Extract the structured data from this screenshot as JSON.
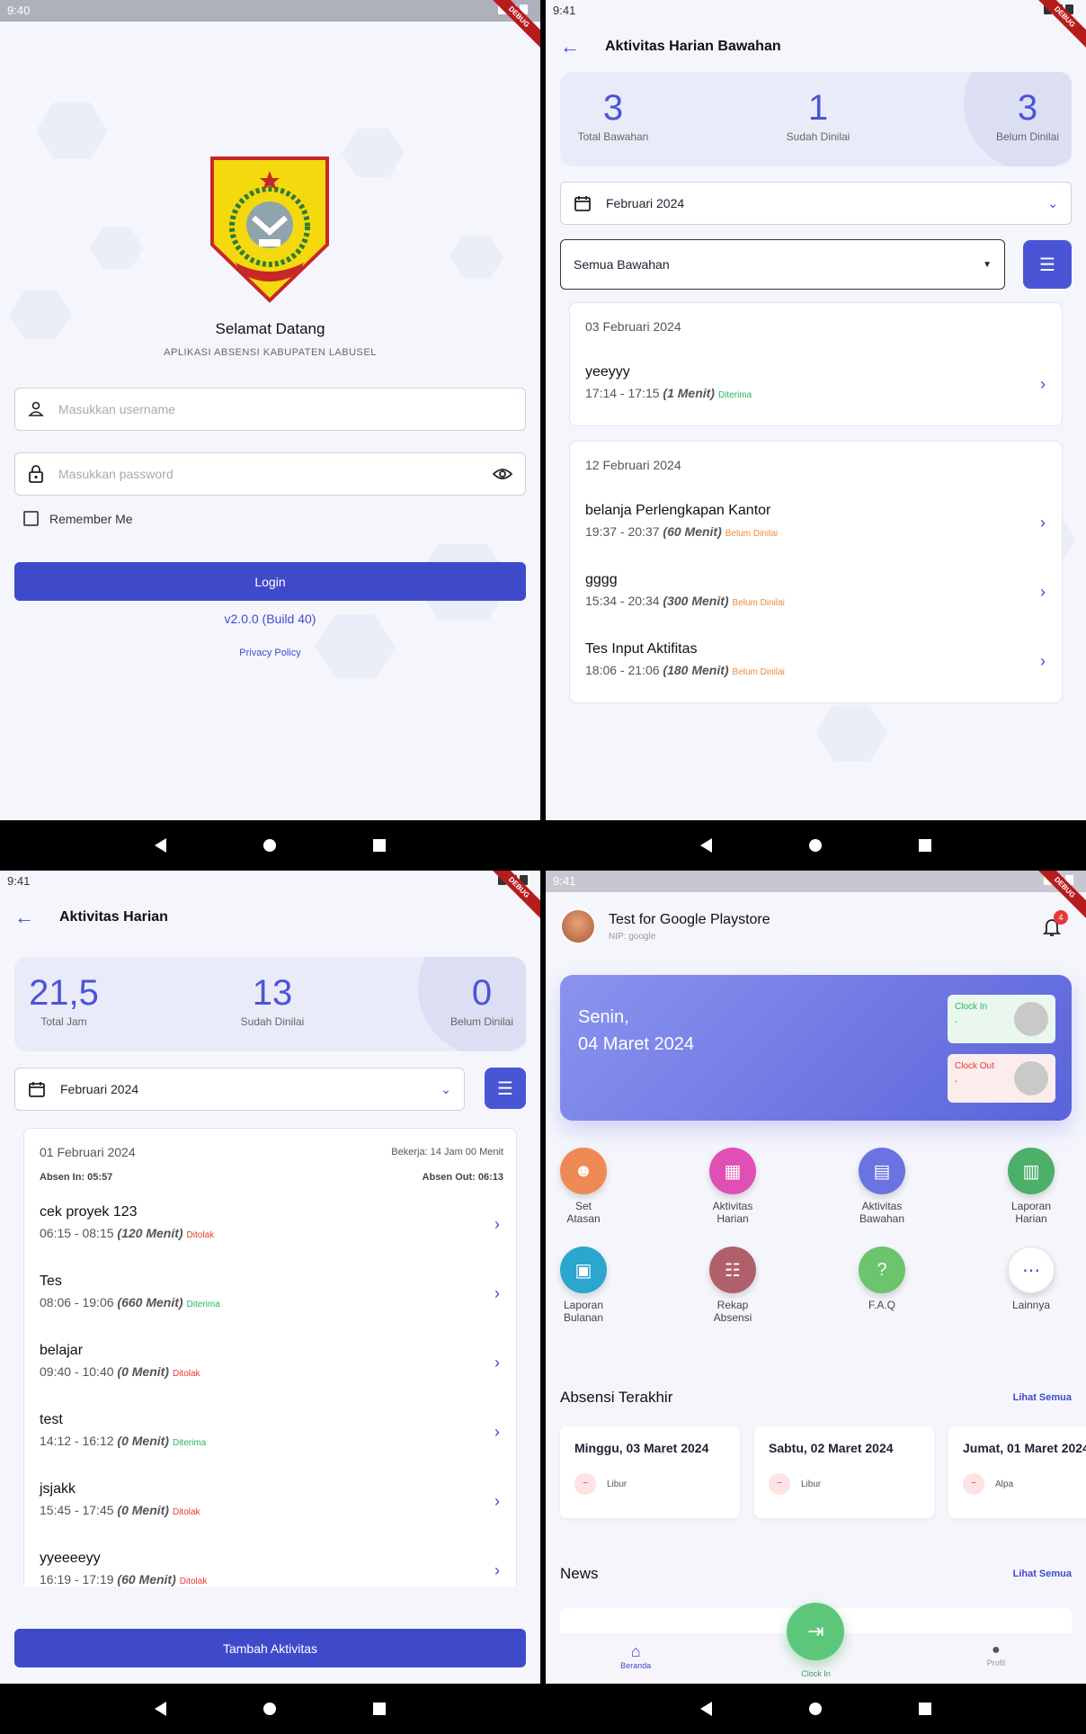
{
  "q1": {
    "time": "9:40",
    "debug": "DEBUG",
    "welcome": "Selamat Datang",
    "subtitle": "APLIKASI ABSENSI KABUPATEN LABUSEL",
    "username_placeholder": "Masukkan username",
    "password_placeholder": "Masukkan password",
    "remember": "Remember Me",
    "login": "Login",
    "version": "v2.0.0 (Build 40)",
    "privacy": "Privacy Policy"
  },
  "q2": {
    "time": "9:41",
    "title": "Aktivitas Harian Bawahan",
    "stats": [
      {
        "num": "3",
        "label": "Total Bawahan"
      },
      {
        "num": "1",
        "label": "Sudah Dinilai"
      },
      {
        "num": "3",
        "label": "Belum Dinilai"
      }
    ],
    "month": "Februari 2024",
    "filter": "Semua Bawahan",
    "groups": [
      {
        "date": "03 Februari 2024",
        "items": [
          {
            "name": "yeeyyy",
            "time": "17:14 - 17:15",
            "dur": "(1 Menit)",
            "status": "Diterima"
          }
        ]
      },
      {
        "date": "12 Februari 2024",
        "items": [
          {
            "name": "belanja Perlengkapan Kantor",
            "time": "19:37 - 20:37",
            "dur": "(60 Menit)",
            "status": "Belum Dinilai"
          },
          {
            "name": "gggg",
            "time": "15:34 - 20:34",
            "dur": "(300 Menit)",
            "status": "Belum Dinilai"
          },
          {
            "name": "Tes Input Aktifitas",
            "time": "18:06 - 21:06",
            "dur": "(180 Menit)",
            "status": "Belum Dinilai"
          }
        ]
      }
    ]
  },
  "q3": {
    "time": "9:41",
    "title": "Aktivitas Harian",
    "stats": [
      {
        "num": "21,5",
        "label": "Total Jam"
      },
      {
        "num": "13",
        "label": "Sudah Dinilai"
      },
      {
        "num": "0",
        "label": "Belum Dinilai"
      }
    ],
    "month": "Februari 2024",
    "card_date": "01 Februari 2024",
    "bekerja": "Bekerja: 14 Jam 00 Menit",
    "absen_in": "Absen In: 05:57",
    "absen_out": "Absen Out: 06:13",
    "items": [
      {
        "name": "cek proyek 123",
        "time": "06:15 - 08:15",
        "dur": "(120 Menit)",
        "status": "Ditolak"
      },
      {
        "name": "Tes",
        "time": "08:06 - 19:06",
        "dur": "(660 Menit)",
        "status": "Diterima"
      },
      {
        "name": "belajar",
        "time": "09:40 - 10:40",
        "dur": "(0 Menit)",
        "status": "Ditolak"
      },
      {
        "name": "test",
        "time": "14:12 - 16:12",
        "dur": "(0 Menit)",
        "status": "Diterima"
      },
      {
        "name": "jsjakk",
        "time": "15:45 - 17:45",
        "dur": "(0 Menit)",
        "status": "Ditolak"
      },
      {
        "name": "yyeeeeyy",
        "time": "16:19 - 17:19",
        "dur": "(60 Menit)",
        "status": "Ditolak"
      }
    ],
    "add_button": "Tambah Aktivitas"
  },
  "q4": {
    "time": "9:41",
    "user": "Test for Google Playstore",
    "nip": "NIP: google",
    "notif_count": "4",
    "day": "Senin,",
    "date": "04 Maret 2024",
    "clock_in_label": "Clock In",
    "clock_in_value": "-",
    "clock_out_label": "Clock Out",
    "clock_out_value": "-",
    "menu": [
      {
        "label": "Set\nAtasan",
        "color": "#ef8a55",
        "icon": "people-icon"
      },
      {
        "label": "Aktivitas\nHarian",
        "color": "#e04fb3",
        "icon": "calendar-icon"
      },
      {
        "label": "Aktivitas\nBawahan",
        "color": "#6a73e0",
        "icon": "clipboard-icon"
      },
      {
        "label": "Laporan\nHarian",
        "color": "#4caf6a",
        "icon": "document-icon"
      },
      {
        "label": "Laporan\nBulanan",
        "color": "#2aa6cf",
        "icon": "report-icon"
      },
      {
        "label": "Rekap\nAbsensi",
        "color": "#b0606a",
        "icon": "checklist-icon"
      },
      {
        "label": "F.A.Q",
        "color": "#6cc46c",
        "icon": "help-icon"
      },
      {
        "label": "Lainnya",
        "color": "#ffffff",
        "icon": "more-icon"
      }
    ],
    "absensi_title": "Absensi Terakhir",
    "lihat_semua": "Lihat Semua",
    "absensi": [
      {
        "date": "Minggu, 03 Maret 2024",
        "status": "Libur"
      },
      {
        "date": "Sabtu, 02 Maret 2024",
        "status": "Libur"
      },
      {
        "date": "Jumat, 01 Maret 2024",
        "status": "Alpa"
      }
    ],
    "news_title": "News",
    "news_link": "Lihat Semua",
    "nav": {
      "home": "Beranda",
      "clock": "Clock In",
      "profile": "Profil"
    }
  },
  "colors": {
    "primary": "#3f4acb",
    "accept": "#22b85a",
    "pending": "#f08a3a",
    "reject": "#e53935"
  }
}
